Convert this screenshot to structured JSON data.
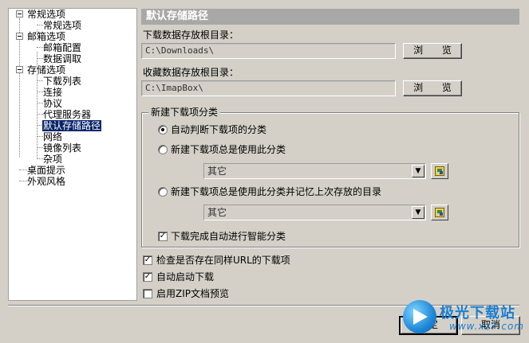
{
  "tree": {
    "items": [
      {
        "label": "常规选项"
      },
      {
        "label": "常规选项"
      },
      {
        "label": "邮箱选项"
      },
      {
        "label": "邮箱配置"
      },
      {
        "label": "数据调取"
      },
      {
        "label": "存储选项"
      },
      {
        "label": "下载列表"
      },
      {
        "label": "连接"
      },
      {
        "label": "协议"
      },
      {
        "label": "代理服务器"
      },
      {
        "label": "默认存储路径"
      },
      {
        "label": "网络"
      },
      {
        "label": "镜像列表"
      },
      {
        "label": "杂项"
      },
      {
        "label": "桌面提示"
      },
      {
        "label": "外观风格"
      }
    ],
    "selected": "默认存储路径"
  },
  "header": {
    "title": "默认存储路径"
  },
  "download_root": {
    "label": "下载数据存放根目录：",
    "value": "C:\\Downloads\\",
    "browse_label": "浏 览"
  },
  "collect_root": {
    "label": "收藏数据存放根目录：",
    "value": "C:\\ImapBox\\",
    "browse_label": "浏 览"
  },
  "category_group": {
    "legend": "新建下载项分类",
    "option_auto": "自动判断下载项的分类",
    "option_fixed": "新建下载项总是使用此分类",
    "option_fixed_remember": "新建下载项总是使用此分类并记忆上次存放的目录",
    "combo1_value": "其它",
    "combo2_value": "其它",
    "smart_category": "下载完成自动进行智能分类"
  },
  "options": {
    "check_same_url": "检查是否存在同样URL的下载项",
    "auto_start": "自动启动下载",
    "zip_preview": "启用ZIP文档预览"
  },
  "buttons": {
    "ok": "确定",
    "cancel": "取消"
  },
  "watermark": {
    "title": "极光下载站",
    "url": "www.xz7.com"
  }
}
